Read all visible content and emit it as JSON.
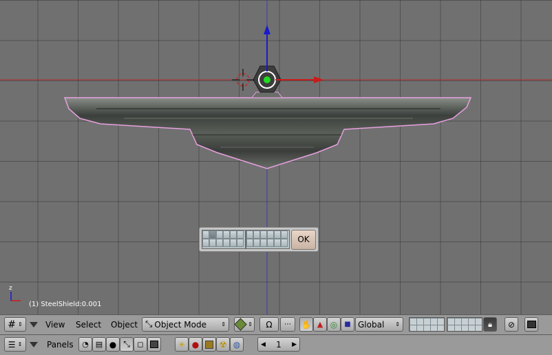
{
  "viewport": {
    "object_info": "(1) SteelShield:0.001",
    "axis_label": "z"
  },
  "popup": {
    "ok_label": "OK"
  },
  "header3d": {
    "view_label": "View",
    "select_label": "Select",
    "object_label": "Object",
    "mode_value": "Object Mode",
    "orientation_value": "Global"
  },
  "buttons_header": {
    "panels_label": "Panels",
    "frame_value": "1"
  },
  "colors": {
    "x_axis": "#cc1a1a",
    "y_axis": "#1a1acc",
    "selection_outline": "#e8a0e0"
  }
}
